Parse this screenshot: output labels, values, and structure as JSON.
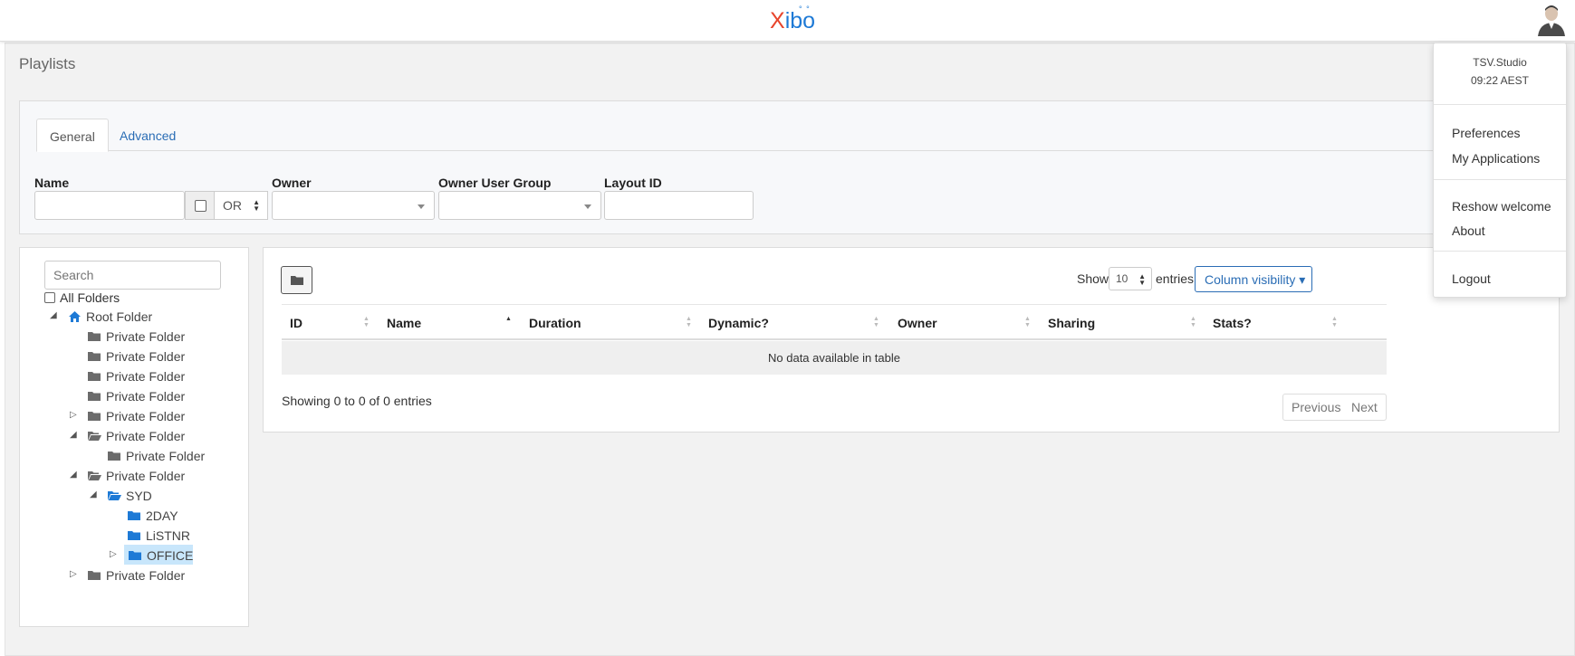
{
  "header": {
    "logo_x": "X",
    "logo_ibo": "ibo",
    "logo_dots": "° °"
  },
  "page": {
    "title": "Playlists"
  },
  "filters": {
    "tabs": [
      {
        "label": "General"
      },
      {
        "label": "Advanced"
      }
    ],
    "name_label": "Name",
    "name_value": "",
    "logic_value": "OR",
    "owner_label": "Owner",
    "owner_value": "",
    "owner_group_label": "Owner User Group",
    "owner_group_value": "",
    "layout_id_label": "Layout ID",
    "layout_id_value": ""
  },
  "tree": {
    "search_placeholder": "Search",
    "all_folders_label": "All Folders",
    "nodes": [
      {
        "label": "Root Folder",
        "icon": "home-icon"
      },
      {
        "label": "Private Folder",
        "icon": "folder-icon"
      },
      {
        "label": "Private Folder",
        "icon": "folder-icon"
      },
      {
        "label": "Private Folder",
        "icon": "folder-icon"
      },
      {
        "label": "Private Folder",
        "icon": "folder-icon"
      },
      {
        "label": "Private Folder",
        "icon": "folder-icon"
      },
      {
        "label": "Private Folder",
        "icon": "folder-open-icon"
      },
      {
        "label": "Private Folder",
        "icon": "folder-icon"
      },
      {
        "label": "Private Folder",
        "icon": "folder-open-icon"
      },
      {
        "label": "SYD",
        "icon": "folder-open-icon"
      },
      {
        "label": "2DAY",
        "icon": "folder-icon"
      },
      {
        "label": "LiSTNR",
        "icon": "folder-icon"
      },
      {
        "label": "OFFICE",
        "icon": "folder-icon",
        "selected": true
      },
      {
        "label": "Private Folder",
        "icon": "folder-icon"
      }
    ]
  },
  "grid": {
    "show_label": "Show",
    "entries_value": "10",
    "entries_label": "entries",
    "column_visibility_label": "Column visibility",
    "columns": [
      "ID",
      "Name",
      "Duration",
      "Dynamic?",
      "Owner",
      "Sharing",
      "Stats?"
    ],
    "empty_message": "No data available in table",
    "info": "Showing 0 to 0 of 0 entries",
    "previous_label": "Previous",
    "next_label": "Next"
  },
  "user_menu": {
    "username": "TSV.Studio",
    "time": "09:22 AEST",
    "items": [
      {
        "label": "Preferences"
      },
      {
        "label": "My Applications"
      },
      {
        "label": "Reshow welcome"
      },
      {
        "label": "About"
      },
      {
        "label": "Logout"
      }
    ]
  },
  "colors": {
    "accent": "#2a6db5",
    "folder_blue": "#1e7ad6",
    "folder_grey": "#6b6b6b",
    "selected_bg": "#c8e6fb",
    "logo_red": "#e8452c"
  }
}
